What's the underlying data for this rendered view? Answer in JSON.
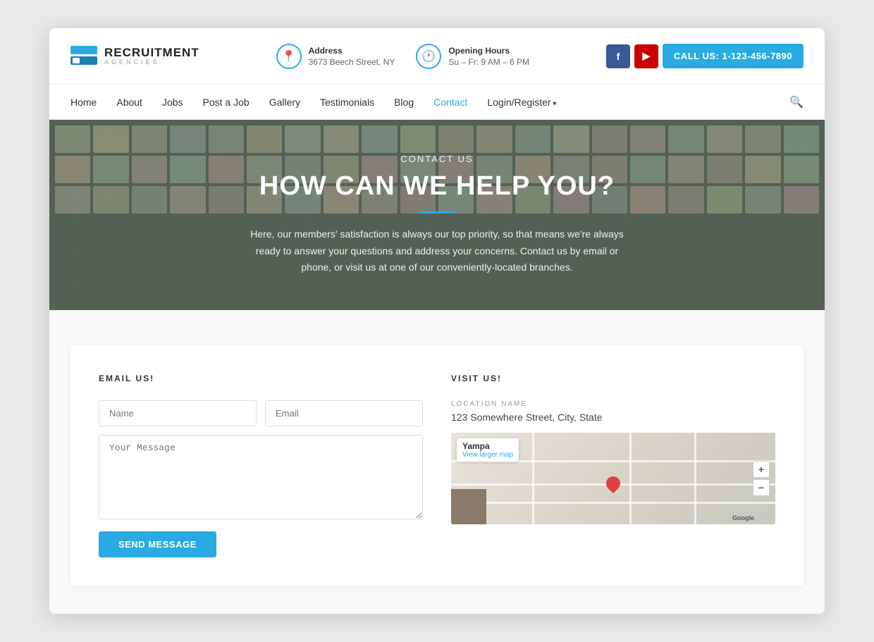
{
  "logo": {
    "main": "RECRUITMENT",
    "sub": "AGENCIES"
  },
  "header": {
    "address_label": "Address",
    "address_value": "3673 Beech Street, NY",
    "hours_label": "Opening Hours",
    "hours_value": "Su – Fr: 9 AM – 6 PM",
    "call_button": "CALL US: 1-123-456-7890"
  },
  "nav": {
    "items": [
      {
        "label": "Home",
        "active": false
      },
      {
        "label": "About",
        "active": false
      },
      {
        "label": "Jobs",
        "active": false
      },
      {
        "label": "Post a Job",
        "active": false
      },
      {
        "label": "Gallery",
        "active": false
      },
      {
        "label": "Testimonials",
        "active": false
      },
      {
        "label": "Blog",
        "active": false
      },
      {
        "label": "Contact",
        "active": true
      },
      {
        "label": "Login/Register",
        "active": false,
        "dropdown": true
      }
    ]
  },
  "hero": {
    "pre_title": "CONTACT US",
    "title": "HOW CAN WE HELP YOU?",
    "description": "Here, our members' satisfaction is always our top priority, so that means we're always ready to answer your questions and address your concerns. Contact us by email or phone, or visit us at one of our conveniently-located branches."
  },
  "email_section": {
    "label": "EMAIL US!",
    "name_placeholder": "Name",
    "email_placeholder": "Email",
    "message_placeholder": "Your Message",
    "submit_label": "SEND MESSAGE"
  },
  "visit_section": {
    "label": "VISIT US!",
    "location_label": "LOCATION NAME",
    "address": "123 Somewhere Street, City, State",
    "map_title": "Yampa",
    "map_link": "View larger map",
    "zoom_in": "+",
    "zoom_out": "−",
    "google_label": "Google"
  },
  "colors": {
    "accent": "#29abe2",
    "facebook": "#3b5998",
    "youtube": "#cc0000"
  }
}
